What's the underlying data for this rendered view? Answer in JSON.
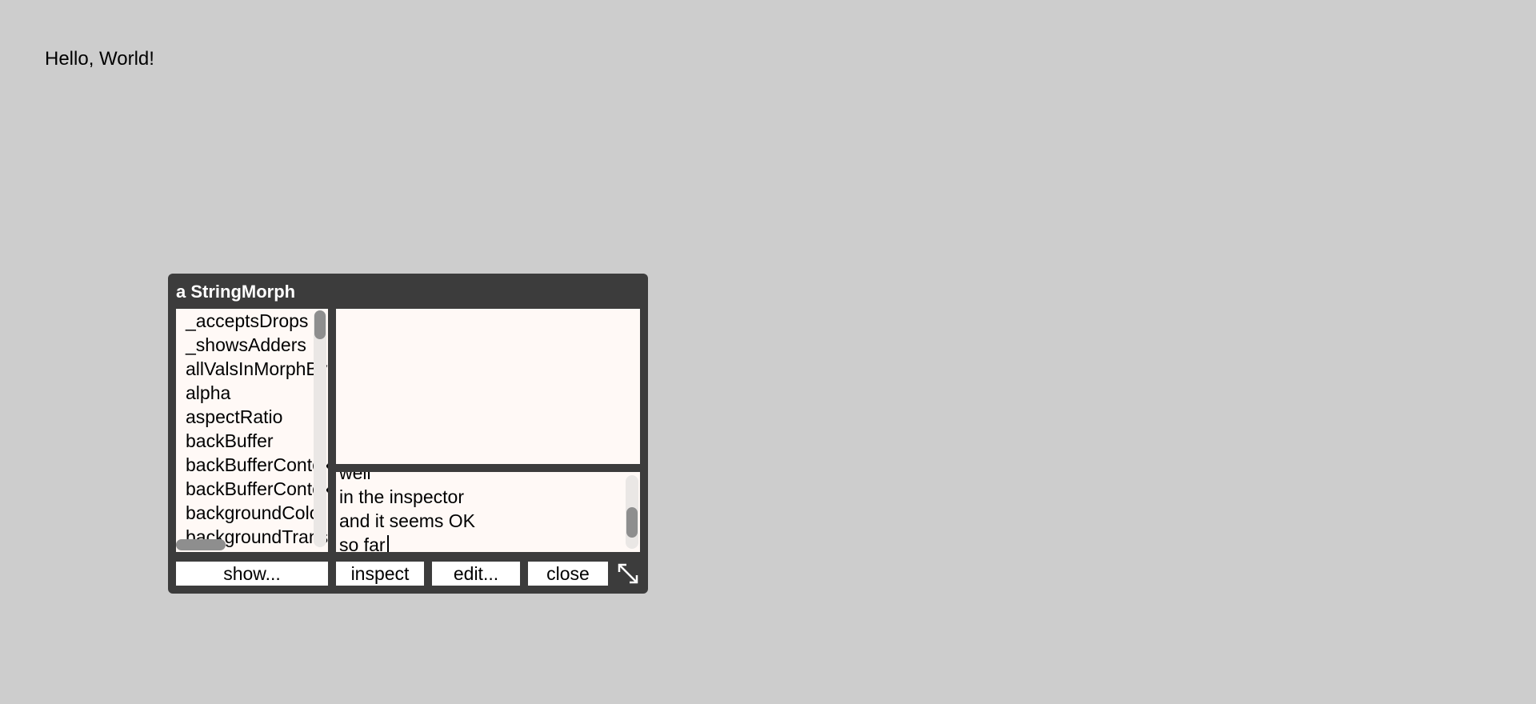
{
  "world": {
    "text_morph": "Hello, World!"
  },
  "inspector": {
    "title": "a StringMorph",
    "slots": [
      "_acceptsDrops",
      "_showsAdders",
      "allValsInMorphByName",
      "alpha",
      "aspectRatio",
      "backBuffer",
      "backBufferContext",
      "backBufferContextCanvas",
      "backgroundColor",
      "backgroundTransparency"
    ],
    "value_text": "",
    "eval_lines": [
      "well",
      "in the inspector",
      "and it seems OK",
      "so far"
    ],
    "buttons": {
      "show": "show...",
      "inspect": "inspect",
      "edit": "edit...",
      "close": "close"
    },
    "resize_icon": "resize-diagonal-icon"
  },
  "colors": {
    "world_background": "#cdcdcd",
    "inspector_frame": "#3c3c3c",
    "pane_background": "#fff9f6",
    "scroll_thumb": "#8e8e8e"
  }
}
